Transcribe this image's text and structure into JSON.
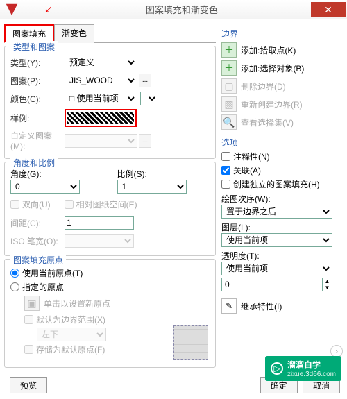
{
  "window": {
    "title": "图案填充和渐变色",
    "close": "✕"
  },
  "tabs": {
    "hatch": "图案填充",
    "gradient": "渐变色"
  },
  "typeGroup": {
    "legend": "类型和图案",
    "typeLbl": "类型(Y):",
    "typeVal": "预定义",
    "patternLbl": "图案(P):",
    "patternVal": "JIS_WOOD",
    "colorLbl": "颜色(C):",
    "colorVal": "□ 使用当前项",
    "sampleLbl": "样例:",
    "customLbl": "自定义图案(M):"
  },
  "angleGroup": {
    "legend": "角度和比例",
    "angleLbl": "角度(G):",
    "angleVal": "0",
    "scaleLbl": "比例(S):",
    "scaleVal": "1",
    "dbl": "双向(U)",
    "rel": "相对图纸空间(E)",
    "spacingLbl": "间距(C):",
    "spacingVal": "1",
    "isoLbl": "ISO 笔宽(O):"
  },
  "originGroup": {
    "legend": "图案填充原点",
    "useCur": "使用当前原点(T)",
    "spec": "指定的原点",
    "clickNew": "单击以设置新原点",
    "defaultBound": "默认为边界范围(X)",
    "posVal": "左下",
    "store": "存储为默认原点(F)"
  },
  "boundary": {
    "title": "边界",
    "addPick": "添加:拾取点(K)",
    "addSel": "添加:选择对象(B)",
    "del": "删除边界(D)",
    "recreate": "重新创建边界(R)",
    "viewSel": "查看选择集(V)"
  },
  "options": {
    "title": "选项",
    "anno": "注释性(N)",
    "assoc": "关联(A)",
    "indep": "创建独立的图案填充(H)",
    "drawOrderLbl": "绘图次序(W):",
    "drawOrderVal": "置于边界之后",
    "layerLbl": "图层(L):",
    "layerVal": "使用当前项",
    "transpLbl": "透明度(T):",
    "transpVal": "使用当前项",
    "transpNum": "0"
  },
  "inherit": "继承特性(I)",
  "footer": {
    "preview": "预览",
    "ok": "确定",
    "cancel": "取消"
  },
  "watermark": {
    "brand": "溜溜自学",
    "url": "zixue.3d66.com"
  }
}
